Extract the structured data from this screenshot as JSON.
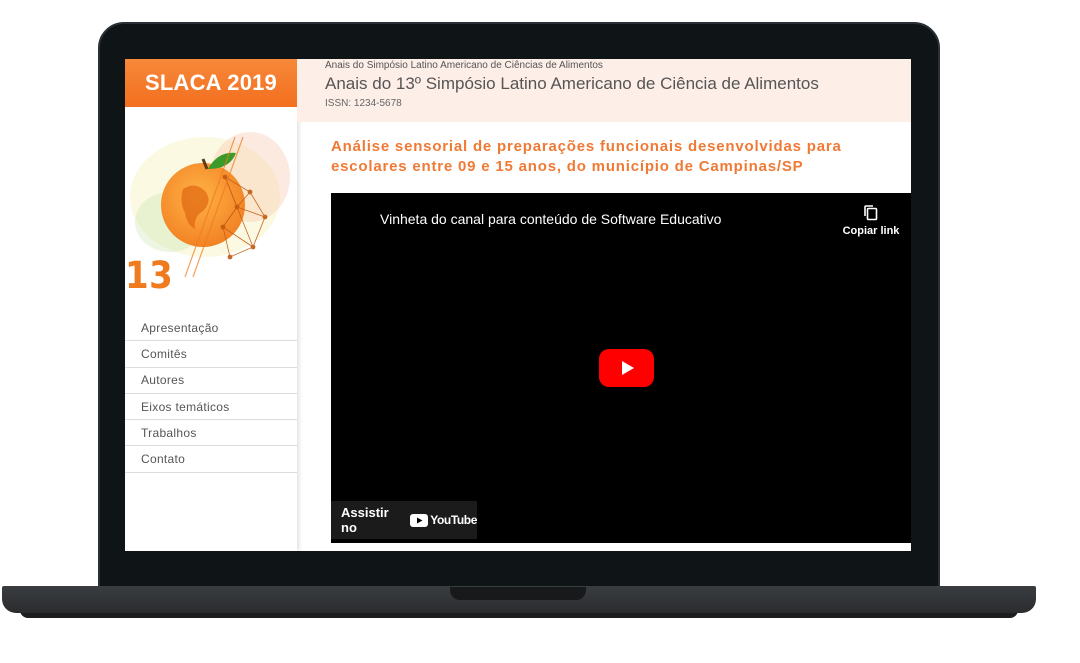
{
  "sidebar": {
    "brand": "SLACA 2019",
    "logo_text": "13 SLACA",
    "items": [
      {
        "label": "Apresentação"
      },
      {
        "label": "Comitês"
      },
      {
        "label": "Autores"
      },
      {
        "label": "Eixos temáticos"
      },
      {
        "label": "Trabalhos"
      },
      {
        "label": "Contato"
      }
    ]
  },
  "header": {
    "subtitle": "Anais do Simpósio Latino Americano de Ciências de Alimentos",
    "title": "Anais do 13º Simpósio Latino Americano de Ciência de Alimentos",
    "issn": "ISSN: 1234-5678"
  },
  "article": {
    "title": "Análise sensorial de preparações funcionais desenvolvidas para escolares entre 09 e 15 anos, do município de Campinas/SP"
  },
  "video": {
    "title": "Vinheta do canal para conteúdo de Software Educativo",
    "copy_link": "Copiar link",
    "watch_on": "Assistir no",
    "platform": "YouTube"
  },
  "colors": {
    "accent": "#f07a1e",
    "header_bg": "#fdeee8",
    "play": "#ff0000"
  },
  "icons": {
    "copy": "copy-icon",
    "play": "play-icon",
    "youtube": "youtube-logo-icon"
  }
}
